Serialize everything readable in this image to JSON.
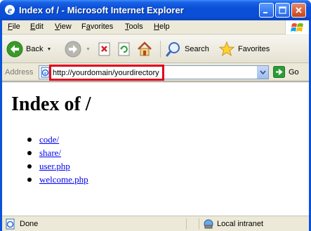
{
  "window": {
    "title": "Index of / - Microsoft Internet Explorer"
  },
  "menu": {
    "items": [
      {
        "pre": "",
        "key": "F",
        "post": "ile"
      },
      {
        "pre": "",
        "key": "E",
        "post": "dit"
      },
      {
        "pre": "",
        "key": "V",
        "post": "iew"
      },
      {
        "pre": "F",
        "key": "a",
        "post": "vorites"
      },
      {
        "pre": "",
        "key": "T",
        "post": "ools"
      },
      {
        "pre": "",
        "key": "H",
        "post": "elp"
      }
    ]
  },
  "toolbar": {
    "back_label": "Back",
    "search_label": "Search",
    "favorites_label": "Favorites"
  },
  "address": {
    "label": "Address",
    "url": "http://yourdomain/yourdirectory",
    "go_label": "Go"
  },
  "page": {
    "heading": "Index of /",
    "files": [
      "code/",
      "share/",
      "user.php",
      "welcome.php"
    ]
  },
  "status": {
    "text": "Done",
    "zone": "Local intranet"
  },
  "colors": {
    "titlebar": "#0a4fd6",
    "highlight": "#e0001a",
    "link": "#0000ee",
    "chrome": "#ece9d8"
  }
}
